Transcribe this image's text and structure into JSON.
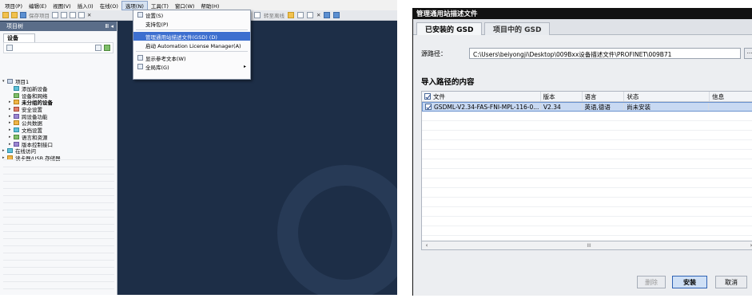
{
  "left": {
    "menu": [
      "项目(P)",
      "编辑(E)",
      "视图(V)",
      "插入(I)",
      "在线(O)",
      "选项(N)",
      "工具(T)",
      "窗口(W)",
      "帮助(H)"
    ],
    "toolbar": {
      "save_label": "保存项目",
      "goto_offline": "转至离线"
    },
    "tree_panel": {
      "header": "项目树",
      "header_icons": "Ⅲ ◂",
      "tab": "设备",
      "items": [
        {
          "label": "项目1",
          "icon": "project-icon",
          "bold": false,
          "arrow": "▾"
        },
        {
          "label": "添加新设备",
          "icon": "add-device-icon",
          "bold": false,
          "arrow": ""
        },
        {
          "label": "设备和网络",
          "icon": "network-icon",
          "bold": false,
          "arrow": ""
        },
        {
          "label": "未分组的设备",
          "icon": "ungrouped-devices-icon",
          "bold": true,
          "arrow": "▸"
        },
        {
          "label": "安全设置",
          "icon": "security-icon",
          "bold": false,
          "arrow": "▸"
        },
        {
          "label": "跨设备功能",
          "icon": "cross-device-icon",
          "bold": false,
          "arrow": "▸"
        },
        {
          "label": "公共数据",
          "icon": "common-data-icon",
          "bold": false,
          "arrow": "▸"
        },
        {
          "label": "文档设置",
          "icon": "document-settings-icon",
          "bold": false,
          "arrow": "▸"
        },
        {
          "label": "语言和资源",
          "icon": "language-icon",
          "bold": false,
          "arrow": "▸"
        },
        {
          "label": "版本控制接口",
          "icon": "version-control-icon",
          "bold": false,
          "arrow": "▸"
        },
        {
          "label": "在线访问",
          "icon": "online-access-icon",
          "bold": false,
          "arrow": "▸"
        },
        {
          "label": "读卡器/USB 存储器",
          "icon": "card-reader-icon",
          "bold": false,
          "arrow": "▸"
        }
      ]
    },
    "dropdown": [
      {
        "label": "设置(S)",
        "icon": "settings-icon",
        "selected": false
      },
      {
        "label": "支持包(P)",
        "icon": "",
        "selected": false
      },
      {
        "sep": true
      },
      {
        "label": "管理通用站描述文件(GSD) (D)",
        "icon": "",
        "selected": true
      },
      {
        "label": "启动 Automation License Manager(A)",
        "icon": "",
        "selected": false
      },
      {
        "sep": true
      },
      {
        "label": "显示参考文本(W)",
        "icon": "reference-text-icon",
        "selected": false
      },
      {
        "label": "全局库(G)",
        "icon": "global-library-icon",
        "selected": false,
        "submenu": true
      }
    ]
  },
  "dialog": {
    "title": "管理通用站描述文件",
    "tabs": [
      "已安装的 GSD",
      "项目中的 GSD"
    ],
    "path_label": "源路径：",
    "path_value": "C:\\Users\\beiyongji\\Desktop\\009Bxx设备描述文件\\PROFINET\\009B71",
    "browse_label": "...",
    "section_title": "导入路径的内容",
    "columns": [
      "文件",
      "版本",
      "语言",
      "状态",
      "信息"
    ],
    "rows": [
      {
        "file": "GSDML-V2.34-FAS-FNI-MPL-116-0...",
        "version": "V2.34",
        "language": "英语,德语",
        "status": "尚未安装",
        "info": ""
      }
    ],
    "scroll_mid": "III",
    "buttons": {
      "delete": "删除",
      "install": "安装",
      "cancel": "取消"
    },
    "accent": "#2f62b4"
  }
}
